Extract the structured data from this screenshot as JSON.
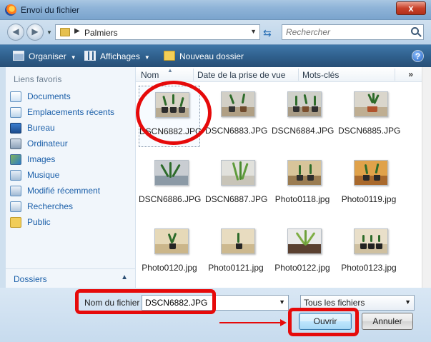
{
  "window": {
    "title": "Envoi du fichier",
    "close_label": "x"
  },
  "address": {
    "path": "Palmiers",
    "search_placeholder": "Rechercher"
  },
  "toolbar": {
    "organize": "Organiser",
    "views": "Affichages",
    "new_folder": "Nouveau dossier",
    "help": "?"
  },
  "sidebar": {
    "title": "Liens favoris",
    "items": [
      {
        "label": "Documents",
        "icon": "documents-icon"
      },
      {
        "label": "Emplacements récents",
        "icon": "recent-places-icon"
      },
      {
        "label": "Bureau",
        "icon": "desktop-icon"
      },
      {
        "label": "Ordinateur",
        "icon": "computer-icon"
      },
      {
        "label": "Images",
        "icon": "pictures-icon"
      },
      {
        "label": "Musique",
        "icon": "music-icon"
      },
      {
        "label": "Modifié récemment",
        "icon": "recently-changed-icon"
      },
      {
        "label": "Recherches",
        "icon": "searches-icon"
      },
      {
        "label": "Public",
        "icon": "public-folder-icon"
      }
    ],
    "folders_label": "Dossiers"
  },
  "columns": [
    "Nom",
    "Date de la prise de vue",
    "Mots-clés"
  ],
  "columns_more": "»",
  "files": [
    {
      "name": "DSCN6882.JPG",
      "selected": true
    },
    {
      "name": "DSCN6883.JPG"
    },
    {
      "name": "DSCN6884.JPG"
    },
    {
      "name": "DSCN6885.JPG"
    },
    {
      "name": "DSCN6886.JPG"
    },
    {
      "name": "DSCN6887.JPG"
    },
    {
      "name": "Photo0118.jpg"
    },
    {
      "name": "Photo0119.jpg"
    },
    {
      "name": "Photo0120.jpg"
    },
    {
      "name": "Photo0121.jpg"
    },
    {
      "name": "Photo0122.jpg"
    },
    {
      "name": "Photo0123.jpg"
    }
  ],
  "bottom": {
    "filename_label": "Nom du fichier :",
    "filename_value": "DSCN6882.JPG",
    "filter": "Tous les fichiers",
    "open": "Ouvrir",
    "cancel": "Annuler"
  },
  "colors": {
    "toolbar": "#2f5f8c",
    "link": "#1b5fa9",
    "annotation": "#e60a0a"
  }
}
